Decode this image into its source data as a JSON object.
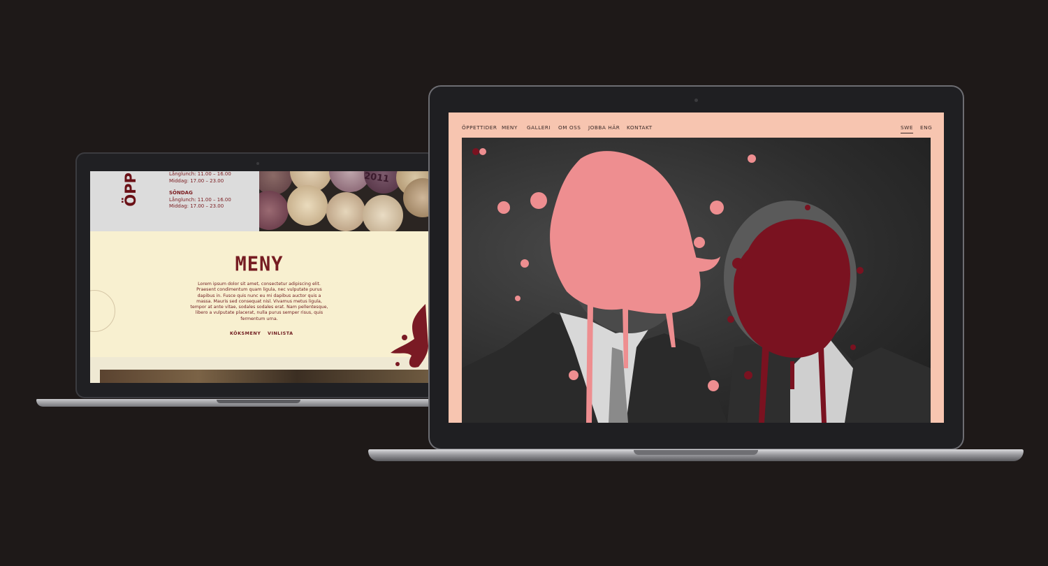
{
  "back_screen": {
    "hours_heading": "ÖPP",
    "hours_lines": [
      {
        "text": "Långlunch: 11.00 – 16.00",
        "bold": false
      },
      {
        "text": "Middag: 17.00 – 23.00",
        "bold": false
      },
      {
        "text": "SÖNDAG",
        "bold": true
      },
      {
        "text": "Långlunch: 11.00 – 16.00",
        "bold": false
      },
      {
        "text": "Middag: 17.00 – 23.00",
        "bold": false
      }
    ],
    "menu_title": "MENY",
    "menu_body": "Lorem ipsum dolor sit amet, consectetur adipiscing elit. Praesent condimentum quam ligula, nec vulputate purus dapibus in. Fusce quis nunc eu mi dapibus auctor quis a massa. Mauris sed consequat nisl. Vivamus metus ligula, tempor at ante vitae, sodales sodales erat. Nam pellentesque, libero a vulputate placerat, nulla purus semper risus, quis fermentum urna.",
    "menu_links": [
      "KÖKSMENY",
      "VINLISTA"
    ],
    "cork_stamp_text": "2011"
  },
  "front_screen": {
    "nav_items": [
      "ÖPPETTIDER",
      "MENY",
      "GALLERI",
      "OM OSS",
      "JOBBA HÄR",
      "KONTAKT"
    ],
    "languages": [
      "SWE",
      "ENG"
    ],
    "active_language": "SWE"
  },
  "colors": {
    "background": "#1e1918",
    "accent_dark_red": "#7a1220",
    "accent_pink": "#ee8e90",
    "front_site_bg": "#f7c5b0",
    "back_site_bg": "#f8f0d0"
  }
}
